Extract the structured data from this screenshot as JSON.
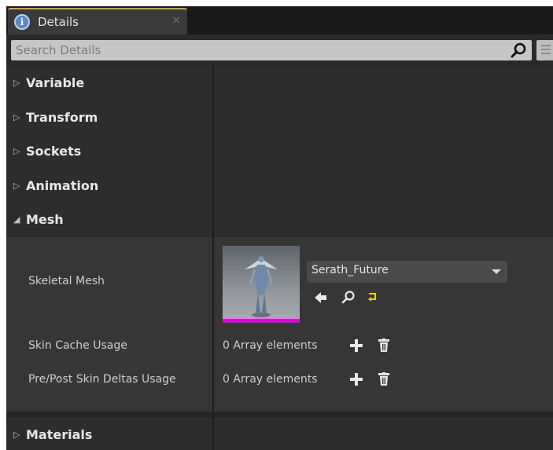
{
  "tab": {
    "title": "Details",
    "icon": "info-icon",
    "close_label": "×",
    "accent": "#d6a43a"
  },
  "search": {
    "placeholder": "Search Details",
    "value": ""
  },
  "categories": [
    {
      "label": "Variable",
      "expanded": false
    },
    {
      "label": "Transform",
      "expanded": false
    },
    {
      "label": "Sockets",
      "expanded": false
    },
    {
      "label": "Animation",
      "expanded": false
    },
    {
      "label": "Mesh",
      "expanded": true
    },
    {
      "label": "Materials",
      "expanded": false
    }
  ],
  "arrows": {
    "collapsed": "▷",
    "expanded": "◢"
  },
  "mesh": {
    "skeletal_mesh": {
      "label": "Skeletal Mesh",
      "value": "Serath_Future",
      "thumbnail_bar_color": "#e000e0"
    },
    "skin_cache_usage": {
      "label": "Skin Cache Usage",
      "value": "0 Array elements"
    },
    "pre_post_skin_deltas": {
      "label": "Pre/Post Skin Deltas Usage",
      "value": "0 Array elements"
    }
  },
  "colors": {
    "panel": "#2d2d2d",
    "mesh_body": "#363636",
    "reset_arrow": "#f0d000"
  }
}
